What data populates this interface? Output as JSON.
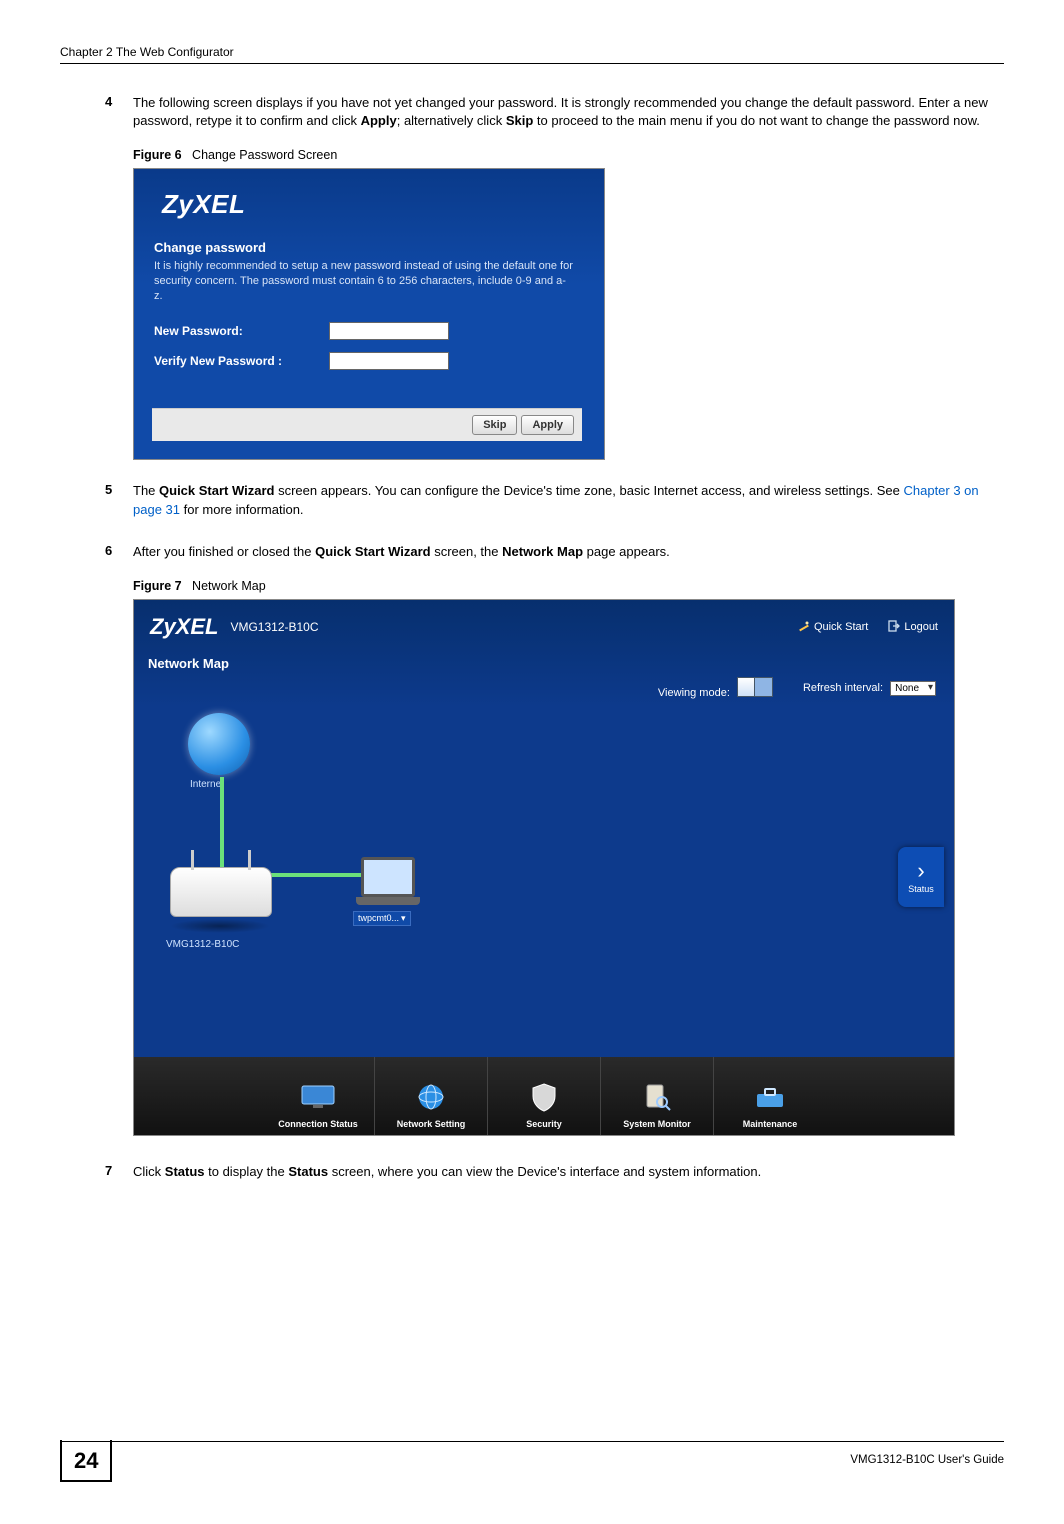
{
  "header": {
    "chapter": "Chapter 2 The Web Configurator"
  },
  "steps": {
    "s4": {
      "num": "4",
      "text_a": "The following screen displays if you have not yet changed your password. It is strongly recommended you change the default password. Enter a new password, retype it to confirm and click ",
      "apply": "Apply",
      "text_b": "; alternatively click ",
      "skip": "Skip",
      "text_c": " to proceed to the main menu if you do not want to change the password now."
    },
    "s5": {
      "num": "5",
      "text_a": "The ",
      "qsw": "Quick Start Wizard",
      "text_b": " screen appears. You can configure the Device's time zone, basic Internet access, and wireless settings. See ",
      "xref": "Chapter 3 on page 31",
      "text_c": " for more information."
    },
    "s6": {
      "num": "6",
      "text_a": "After you finished or closed the ",
      "qsw": "Quick Start Wizard",
      "text_b": " screen, the ",
      "nmap": "Network Map",
      "text_c": " page appears."
    },
    "s7": {
      "num": "7",
      "text_a": "Click ",
      "status1": "Status",
      "text_b": " to display the ",
      "status2": "Status",
      "text_c": " screen, where you can view the Device's interface and system information."
    }
  },
  "fig6": {
    "caption_label": "Figure 6",
    "caption_text": "Change Password Screen",
    "logo": "ZyXEL",
    "title": "Change password",
    "desc": "It is highly recommended to setup a new password instead of using the default one for security concern. The password must contain 6 to 256 characters, include 0-9 and a-z.",
    "label_new": "New Password:",
    "label_verify": "Verify New Password :",
    "btn_skip": "Skip",
    "btn_apply": "Apply"
  },
  "fig7": {
    "caption_label": "Figure 7",
    "caption_text": "Network Map",
    "logo": "ZyXEL",
    "model": "VMG1312-B10C",
    "quick_start": "Quick Start",
    "logout": "Logout",
    "nm_title": "Network Map",
    "viewing_mode": "Viewing mode:",
    "refresh_interval": "Refresh interval:",
    "refresh_value": "None",
    "internet_label": "Internet",
    "router_label": "VMG1312-B10C",
    "laptop_tag": "twpcmt0...",
    "status_label": "Status",
    "bottom": {
      "connection": "Connection Status",
      "network": "Network Setting",
      "security": "Security",
      "monitor": "System Monitor",
      "maintenance": "Maintenance"
    }
  },
  "footer": {
    "page": "24",
    "guide": "VMG1312-B10C User's Guide"
  }
}
